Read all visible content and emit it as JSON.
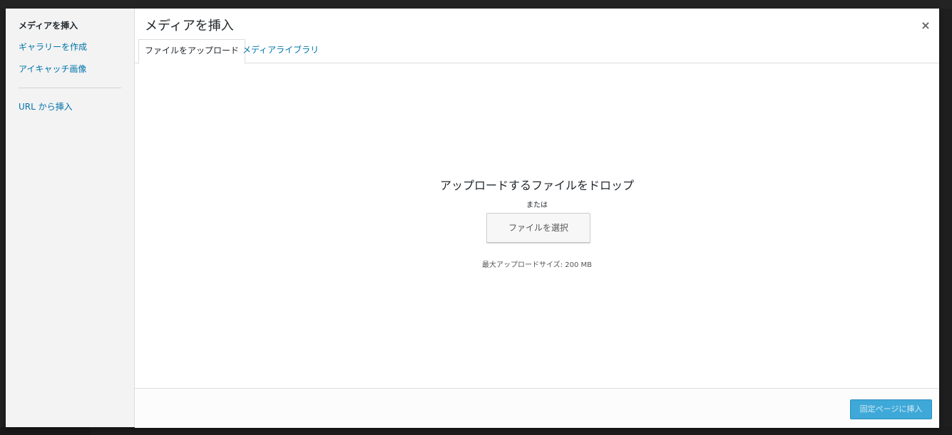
{
  "modal": {
    "title": "メディアを挿入",
    "close_icon": "×"
  },
  "menu": {
    "items": [
      {
        "label": "メディアを挿入"
      },
      {
        "label": "ギャラリーを作成"
      },
      {
        "label": "アイキャッチ画像"
      },
      {
        "label": "URL から挿入"
      }
    ]
  },
  "tabs": [
    {
      "label": "ファイルをアップロード"
    },
    {
      "label": "メディアライブラリ"
    }
  ],
  "uploader": {
    "drop_title": "アップロードするファイルをドロップ",
    "or_text": "または",
    "select_button": "ファイルを選択",
    "max_size": "最大アップロードサイズ: 200 MB"
  },
  "toolbar": {
    "insert_button": "固定ページに挿入"
  },
  "colors": {
    "link": "#0073aa",
    "primary_button": "#3ea9d8",
    "menu_bg": "#f3f3f3"
  }
}
